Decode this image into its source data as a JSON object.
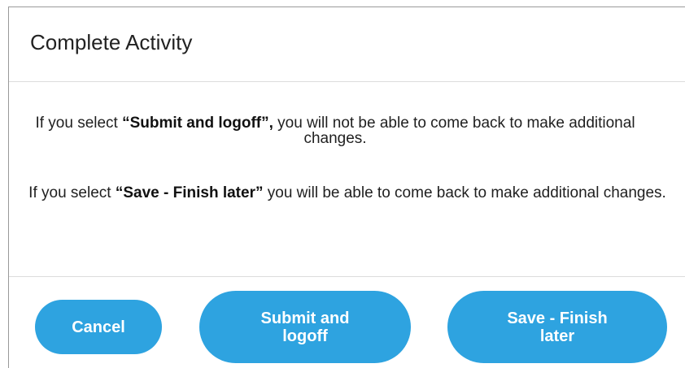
{
  "dialog": {
    "title": "Complete Activity",
    "message1": {
      "prefix": "If you select ",
      "bold": "“Submit and logoff”,",
      "suffix": " you will not be able to come back to make additional changes."
    },
    "message2": {
      "prefix": "If you select ",
      "bold": "“Save - Finish later”",
      "suffix": " you will be able to come back to make additional changes."
    }
  },
  "buttons": {
    "cancel": "Cancel",
    "submit": "Submit and logoff",
    "save": "Save - Finish later"
  },
  "colors": {
    "button_bg": "#2ea3e0",
    "button_text": "#ffffff"
  }
}
